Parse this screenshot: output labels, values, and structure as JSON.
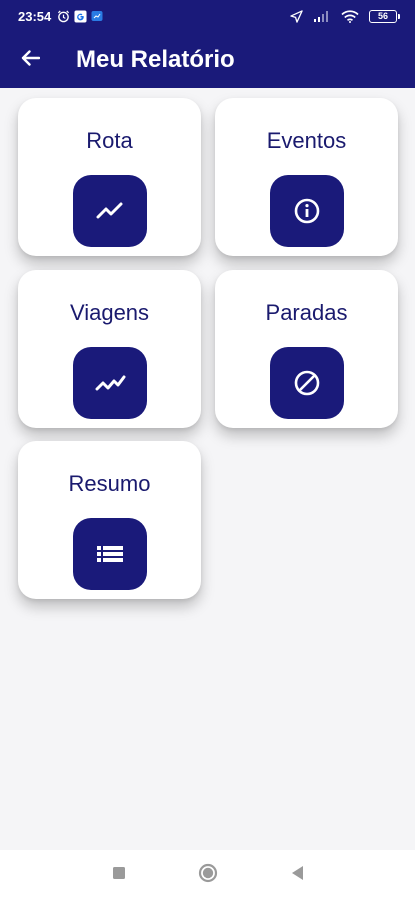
{
  "status_bar": {
    "time": "23:54",
    "battery": "56",
    "icons": [
      "alarm-icon",
      "google-icon",
      "message-icon",
      "location-icon",
      "signal-icon",
      "wifi-icon",
      "battery-icon"
    ]
  },
  "app_bar": {
    "title": "Meu Relatório",
    "back_icon": "arrow-left-icon"
  },
  "cards": [
    {
      "label": "Rota",
      "icon": "trending-up-icon"
    },
    {
      "label": "Eventos",
      "icon": "info-icon"
    },
    {
      "label": "Viagens",
      "icon": "multiline-chart-icon"
    },
    {
      "label": "Paradas",
      "icon": "block-icon"
    },
    {
      "label": "Resumo",
      "icon": "list-icon"
    }
  ],
  "nav_bar": {
    "icons": [
      "recent-apps-icon",
      "home-icon",
      "back-icon"
    ]
  },
  "colors": {
    "primary": "#1a1a7a",
    "card_label": "#1a1a6e",
    "background": "#f5f5f7"
  }
}
